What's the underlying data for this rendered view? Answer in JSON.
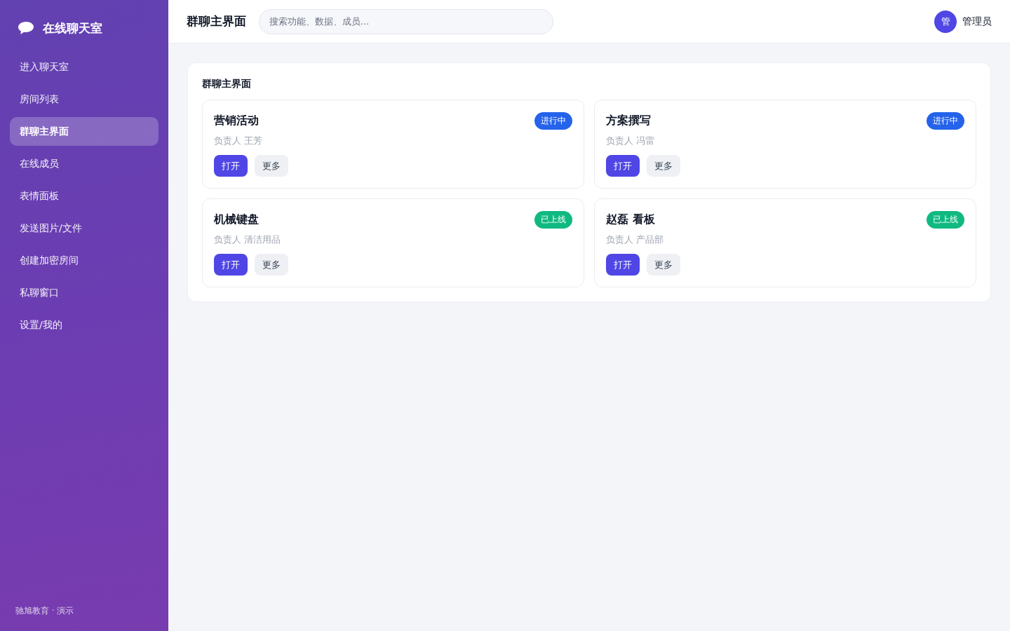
{
  "sidebar": {
    "brand": "在线聊天室",
    "items": [
      {
        "label": "进入聊天室",
        "selected": false
      },
      {
        "label": "房间列表",
        "selected": false
      },
      {
        "label": "群聊主界面",
        "selected": true
      },
      {
        "label": "在线成员",
        "selected": false
      },
      {
        "label": "表情面板",
        "selected": false
      },
      {
        "label": "发送图片/文件",
        "selected": false
      },
      {
        "label": "创建加密房间",
        "selected": false
      },
      {
        "label": "私聊窗口",
        "selected": false
      },
      {
        "label": "设置/我的",
        "selected": false
      }
    ],
    "footer": "驰旭教育 · 演示"
  },
  "header": {
    "title": "群聊主界面",
    "search": {
      "placeholder": "搜索功能、数据、成员..."
    },
    "user": {
      "avatar": "管",
      "name": "管理员"
    }
  },
  "panel": {
    "title": "群聊主界面",
    "cards": [
      {
        "title": "营销活动",
        "badge": {
          "text": "进行中",
          "color": "#2563eb"
        },
        "owner": "负责人 王芳",
        "buttons": [
          {
            "label": "打开",
            "kind": "primary"
          },
          {
            "label": "更多",
            "kind": "secondary"
          }
        ]
      },
      {
        "title": "方案撰写",
        "badge": {
          "text": "进行中",
          "color": "#2563eb"
        },
        "owner": "负责人 冯雷",
        "buttons": [
          {
            "label": "打开",
            "kind": "primary"
          },
          {
            "label": "更多",
            "kind": "secondary"
          }
        ]
      },
      {
        "title": "机械键盘",
        "badge": {
          "text": "已上线",
          "color": "#10b981"
        },
        "owner": "负责人 清洁用品",
        "buttons": [
          {
            "label": "打开",
            "kind": "primary"
          },
          {
            "label": "更多",
            "kind": "secondary"
          }
        ]
      },
      {
        "title": "赵磊 看板",
        "badge": {
          "text": "已上线",
          "color": "#10b981"
        },
        "owner": "负责人 产品部",
        "buttons": [
          {
            "label": "打开",
            "kind": "primary"
          },
          {
            "label": "更多",
            "kind": "secondary"
          }
        ]
      }
    ]
  }
}
